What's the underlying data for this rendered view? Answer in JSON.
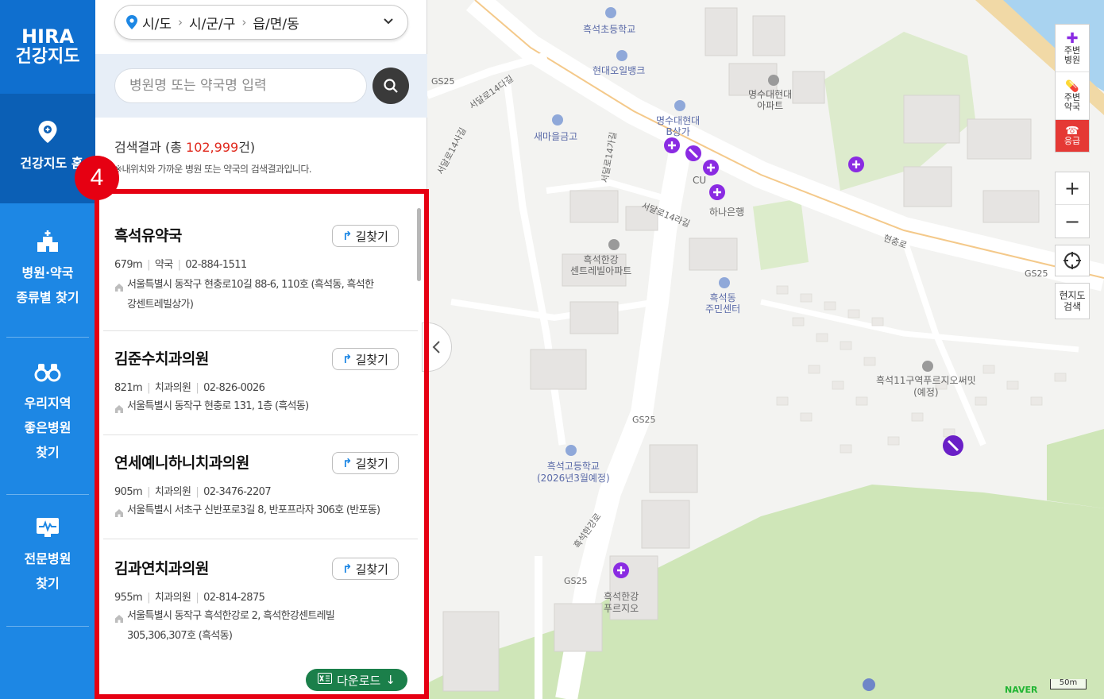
{
  "nav": {
    "logo_line1": "HIRA",
    "logo_line2": "건강지도",
    "home": "건강지도 홈",
    "type_search": "병원·약국\n종류별 찾기",
    "good_hospital": "우리지역\n좋은병원\n찾기",
    "specialty": "전문병원\n찾기"
  },
  "region": {
    "sido": "시/도",
    "sigungu": "시/군/구",
    "emd": "읍/면/동"
  },
  "search": {
    "placeholder": "병원명 또는 약국명 입력"
  },
  "results": {
    "prefix": "검색결과 (총 ",
    "count": "102,999",
    "suffix": "건)",
    "note": "※내위치와 가까운 병원 또는 약국의 검색결과입니다."
  },
  "directions_label": "길찾기",
  "items": [
    {
      "name": "흑석유약국",
      "distance": "679m",
      "type": "약국",
      "phone": "02-884-1511",
      "address": "서울특별시 동작구 현충로10길 88-6, 110호 (흑석동, 흑석한강센트레빌상가)"
    },
    {
      "name": "김준수치과의원",
      "distance": "821m",
      "type": "치과의원",
      "phone": "02-826-0026",
      "address": "서울특별시 동작구 현충로 131, 1층 (흑석동)"
    },
    {
      "name": "연세예니하니치과의원",
      "distance": "905m",
      "type": "치과의원",
      "phone": "02-3476-2207",
      "address": "서울특별시 서초구 신반포로3길 8, 반포프라자 306호 (반포동)"
    },
    {
      "name": "김과연치과의원",
      "distance": "955m",
      "type": "치과의원",
      "phone": "02-814-2875",
      "address": "서울특별시 동작구 흑석한강로 2, 흑석한강센트레빌 305,306,307호 (흑석동)"
    }
  ],
  "download_label": "다운로드",
  "badge": "4",
  "map_controls": {
    "nearby_hospital": "주변\n병원",
    "nearby_pharmacy": "주변\n약국",
    "emergency": "응급",
    "zoom_in": "+",
    "zoom_out": "−",
    "current_search": "현지도\n검색",
    "scale": "50m",
    "provider": "NAVER"
  },
  "map_labels": {
    "school1": "흑석초등학교",
    "bank1": "현대오일뱅크",
    "saemaeul": "새마을금고",
    "myungsu": "명수대현대\nB상가",
    "myungsu_apt": "명수대현대\n아파트",
    "cu": "CU",
    "hana": "하나은행",
    "centreville": "흑석한강\n센트레빌아파트",
    "community": "흑석동\n주민센터",
    "redev": "흑석11구역푸르지오써밋\n(예정)",
    "highschool": "흑석고등학교\n(2026년3월예정)",
    "prugio": "흑석한강\n푸르지오",
    "road1": "서달로14라길",
    "road2": "서달로14사길",
    "road3": "서달로14가길",
    "road4": "서달로14다길",
    "road5": "현충로",
    "road6": "흑석한강로",
    "gs1": "GS25",
    "gs2": "GS25",
    "gs3": "GS25",
    "gs4": "GS25"
  },
  "colors": {
    "nav_blue": "#1d87e4",
    "highlight_red": "#e60012",
    "download_green": "#1b7f4a",
    "count_red": "#e0281c",
    "pin_purple": "#8a2be2"
  }
}
